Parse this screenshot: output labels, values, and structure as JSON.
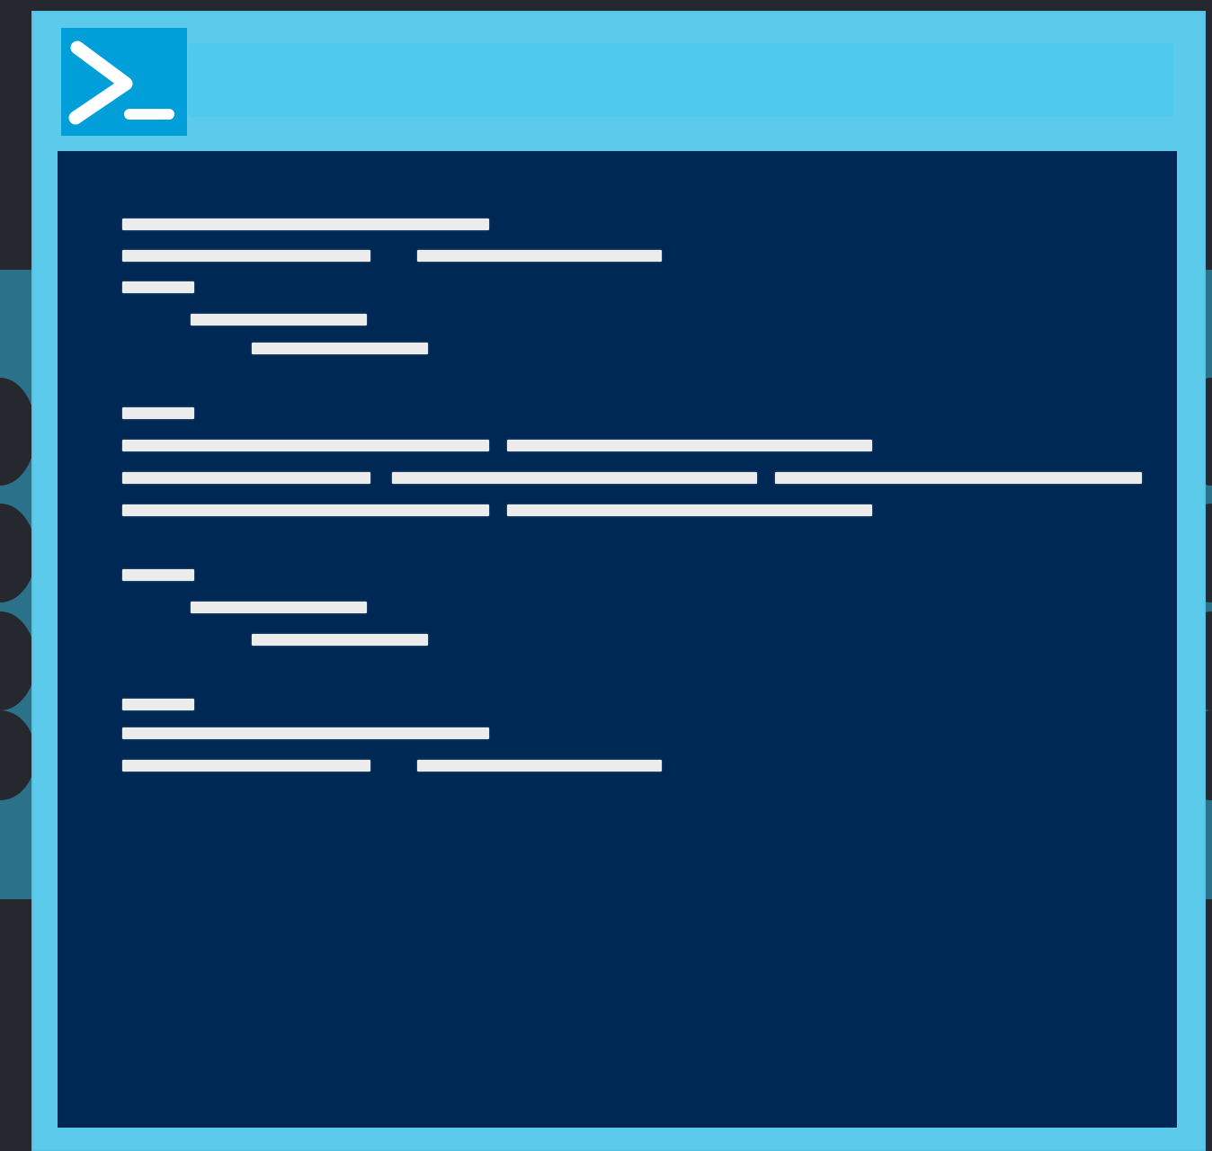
{
  "app": {
    "name": "PowerShell",
    "icon": "powershell-prompt-icon",
    "colors": {
      "window_frame": "#5ccbeb",
      "titlebar_strip": "#4dcaee",
      "icon_background": "#009fd9",
      "console_background": "#002855",
      "text_placeholder": "#ececec",
      "page_background": "#25282f"
    }
  },
  "console": {
    "lines": []
  }
}
